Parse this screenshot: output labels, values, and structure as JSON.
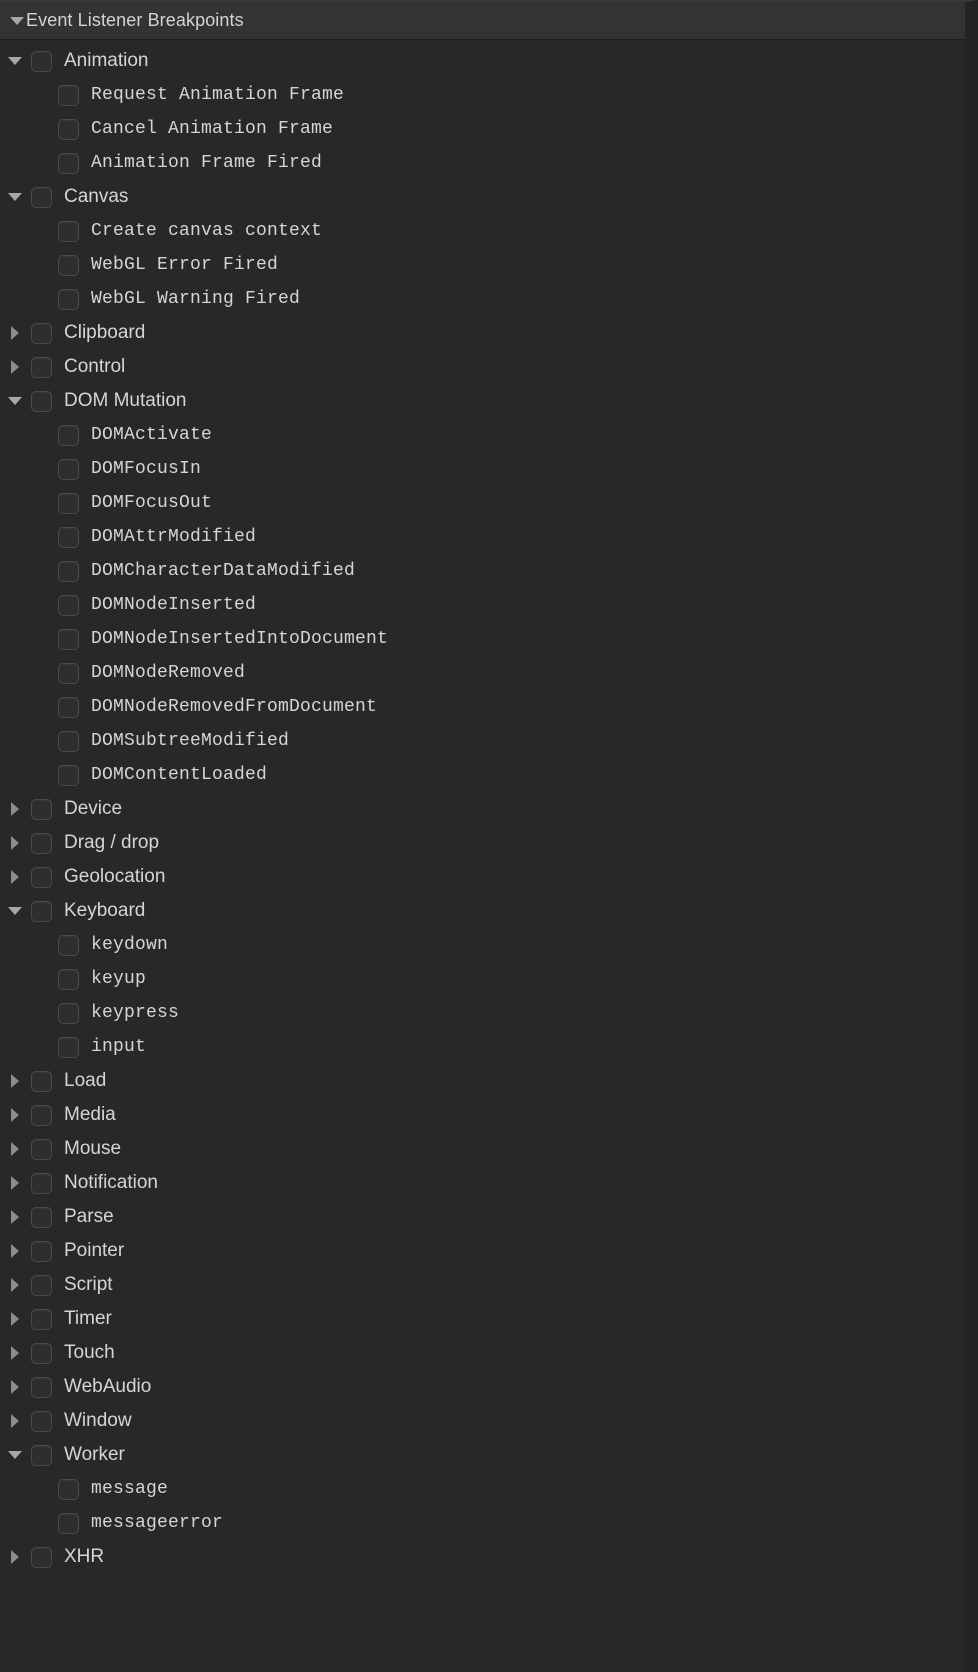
{
  "panel": {
    "title": "Event Listener Breakpoints",
    "expanded": true,
    "colors": {
      "header_background": "#333333",
      "panel_background": "#282828",
      "text": "#d3d5d7",
      "checkbox_background": "#2e2e2e",
      "checkbox_border": "#4a4a4a",
      "twisty": "#a8a8a8"
    }
  },
  "groups": [
    {
      "label": "Animation",
      "expanded": true,
      "checked": false,
      "children": [
        {
          "label": "Request Animation Frame",
          "checked": false
        },
        {
          "label": "Cancel Animation Frame",
          "checked": false
        },
        {
          "label": "Animation Frame Fired",
          "checked": false
        }
      ]
    },
    {
      "label": "Canvas",
      "expanded": true,
      "checked": false,
      "children": [
        {
          "label": "Create canvas context",
          "checked": false
        },
        {
          "label": "WebGL Error Fired",
          "checked": false
        },
        {
          "label": "WebGL Warning Fired",
          "checked": false
        }
      ]
    },
    {
      "label": "Clipboard",
      "expanded": false,
      "checked": false,
      "children": []
    },
    {
      "label": "Control",
      "expanded": false,
      "checked": false,
      "children": []
    },
    {
      "label": "DOM Mutation",
      "expanded": true,
      "checked": false,
      "children": [
        {
          "label": "DOMActivate",
          "checked": false
        },
        {
          "label": "DOMFocusIn",
          "checked": false
        },
        {
          "label": "DOMFocusOut",
          "checked": false
        },
        {
          "label": "DOMAttrModified",
          "checked": false
        },
        {
          "label": "DOMCharacterDataModified",
          "checked": false
        },
        {
          "label": "DOMNodeInserted",
          "checked": false
        },
        {
          "label": "DOMNodeInsertedIntoDocument",
          "checked": false
        },
        {
          "label": "DOMNodeRemoved",
          "checked": false
        },
        {
          "label": "DOMNodeRemovedFromDocument",
          "checked": false
        },
        {
          "label": "DOMSubtreeModified",
          "checked": false
        },
        {
          "label": "DOMContentLoaded",
          "checked": false
        }
      ]
    },
    {
      "label": "Device",
      "expanded": false,
      "checked": false,
      "children": []
    },
    {
      "label": "Drag / drop",
      "expanded": false,
      "checked": false,
      "children": []
    },
    {
      "label": "Geolocation",
      "expanded": false,
      "checked": false,
      "children": []
    },
    {
      "label": "Keyboard",
      "expanded": true,
      "checked": false,
      "children": [
        {
          "label": "keydown",
          "checked": false
        },
        {
          "label": "keyup",
          "checked": false
        },
        {
          "label": "keypress",
          "checked": false
        },
        {
          "label": "input",
          "checked": false
        }
      ]
    },
    {
      "label": "Load",
      "expanded": false,
      "checked": false,
      "children": []
    },
    {
      "label": "Media",
      "expanded": false,
      "checked": false,
      "children": []
    },
    {
      "label": "Mouse",
      "expanded": false,
      "checked": false,
      "children": []
    },
    {
      "label": "Notification",
      "expanded": false,
      "checked": false,
      "children": []
    },
    {
      "label": "Parse",
      "expanded": false,
      "checked": false,
      "children": []
    },
    {
      "label": "Pointer",
      "expanded": false,
      "checked": false,
      "children": []
    },
    {
      "label": "Script",
      "expanded": false,
      "checked": false,
      "children": []
    },
    {
      "label": "Timer",
      "expanded": false,
      "checked": false,
      "children": []
    },
    {
      "label": "Touch",
      "expanded": false,
      "checked": false,
      "children": []
    },
    {
      "label": "WebAudio",
      "expanded": false,
      "checked": false,
      "children": []
    },
    {
      "label": "Window",
      "expanded": false,
      "checked": false,
      "children": []
    },
    {
      "label": "Worker",
      "expanded": true,
      "checked": false,
      "children": [
        {
          "label": "message",
          "checked": false
        },
        {
          "label": "messageerror",
          "checked": false
        }
      ]
    },
    {
      "label": "XHR",
      "expanded": false,
      "checked": false,
      "children": []
    }
  ]
}
